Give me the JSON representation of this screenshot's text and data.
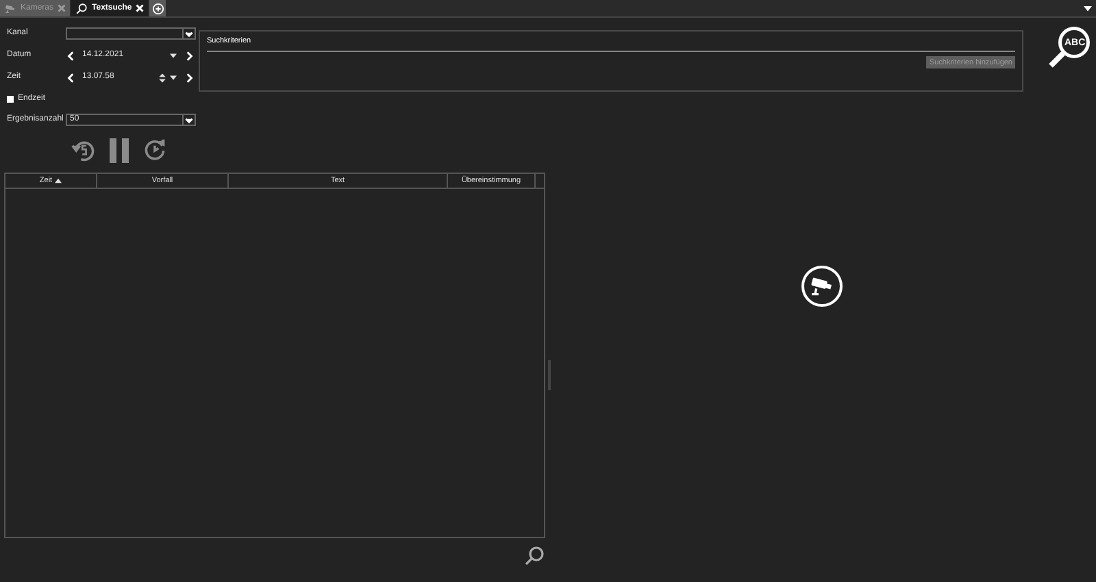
{
  "tabs": [
    {
      "label": "Kameras",
      "kind": "camera",
      "selected": false
    },
    {
      "label": "Textsuche",
      "kind": "search",
      "selected": true
    }
  ],
  "form": {
    "channel": {
      "label": "Kanal"
    },
    "date": {
      "label": "Datum",
      "value": "14.12.2021"
    },
    "time": {
      "label": "Zeit",
      "value": "13.07.58"
    },
    "end_time": {
      "label": "Endzeit",
      "checked": false
    },
    "result_count": {
      "label": "Ergebnisanzahl",
      "value": "50"
    }
  },
  "search_criteria": {
    "title": "Suchkriterien",
    "add_button": "Suchkriterien hinzufügen",
    "add_disabled": true
  },
  "text_search_icon": "ABC",
  "table": {
    "columns": [
      {
        "label": "Zeit",
        "sorted": true
      },
      {
        "label": "Vorfall",
        "sorted": false
      },
      {
        "label": "Text",
        "sorted": false
      },
      {
        "label": "Übereinstimmung",
        "sorted": false
      }
    ]
  }
}
